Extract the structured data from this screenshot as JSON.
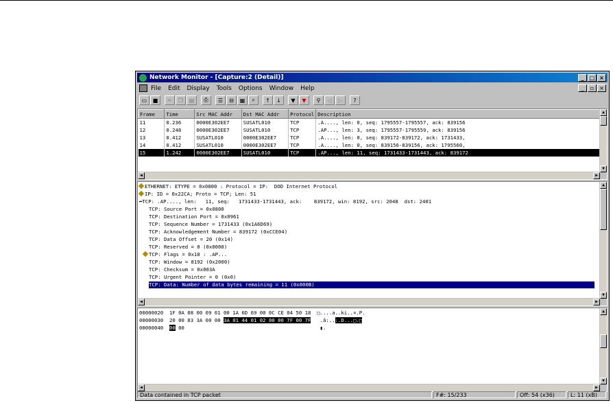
{
  "window": {
    "title": "Network Monitor - [Capture:2 (Detail)]"
  },
  "menu": [
    "File",
    "Edit",
    "Display",
    "Tools",
    "Options",
    "Window",
    "Help"
  ],
  "summary": {
    "columns": [
      "Frame",
      "Time",
      "Src MAC Addr",
      "Dst MAC Addr",
      "Protocol",
      "Description"
    ],
    "rows": [
      [
        "11",
        "0.236",
        "0000E302EE7",
        "SUSATL010",
        "TCP",
        ".A...., len:    0, seq:   1795557-1795557, ack:    839156"
      ],
      [
        "12",
        "0.248",
        "0000E302EE7",
        "SUSATL010",
        "TCP",
        ".AP..., len:    3, seq:   1795557-1795559, ack:    839156"
      ],
      [
        "13",
        "0.412",
        "SUSATL010",
        "0000E302EE7",
        "TCP",
        ".A...., len:    0, seq:    839172-839172, ack:   1731433,"
      ],
      [
        "14",
        "0.412",
        "SUSATL010",
        "0000E302EE7",
        "TCP",
        ".A...., len:    0, seq:    839156-839156, ack:   1795560,"
      ],
      [
        "15",
        "1.242",
        "0000E302EE7",
        "SUSATL010",
        "TCP",
        ".AP..., len:   11, seq:   1731433-1731443, ack:    839172"
      ]
    ]
  },
  "detail": {
    "lines": [
      "ETHERNET: ETYPE = 0x0800 : Protocol = IP:  DOD Internet Protocol",
      "IP: ID = 0x22CA; Proto = TCP; Len: 51",
      "TCP: .AP...., len:   11, seq:   1731433-1731443, ack:    839172, win: 8192, src: 2048  dst: 2401",
      "TCP: Source Port = 0x0800",
      "TCP: Destination Port = 0x0961",
      "TCP: Sequence Number = 1731433 (0x1A6D69)",
      "TCP: Acknowledgement Number = 839172 (0xCCE04)",
      "TCP: Data Offset = 20 (0x14)",
      "TCP: Reserved = 0 (0x0000)",
      "TCP: Flags = 0x18 : .AP...",
      "TCP: Window = 8192 (0x2000)",
      "TCP: Checksum = 0x003A",
      "TCP: Urgent Pointer = 0 (0x0)",
      "TCP: Data: Number of data bytes remaining = 11 (0x000B)"
    ]
  },
  "hex": {
    "l1_off": "00000020",
    "l1_hex": "1F 0A 08 00 09 61 00 1A 6D 69 00 0C CE 04 50 18",
    "l1_asc": "□....a..ki..¤.P.",
    "l2_off": "00000030",
    "l2_hex_a": "20 00 83 3A 00 00",
    "l2_hex_b": "3A 01 44 01 02 00 00 7F 00 7F",
    "l2_asc_a": " .â:..",
    "l2_asc_b": ":.D...□.□",
    "l3_off": "00000040",
    "l3_hex_a": "00",
    "l3_hex_b": "00",
    "l3_asc": "▮."
  },
  "status": {
    "message": "Data contained in TCP packet",
    "frame": "F#: 15/233",
    "offset": "Off: 54 (x36)",
    "length": "L: 11 (xB)"
  }
}
